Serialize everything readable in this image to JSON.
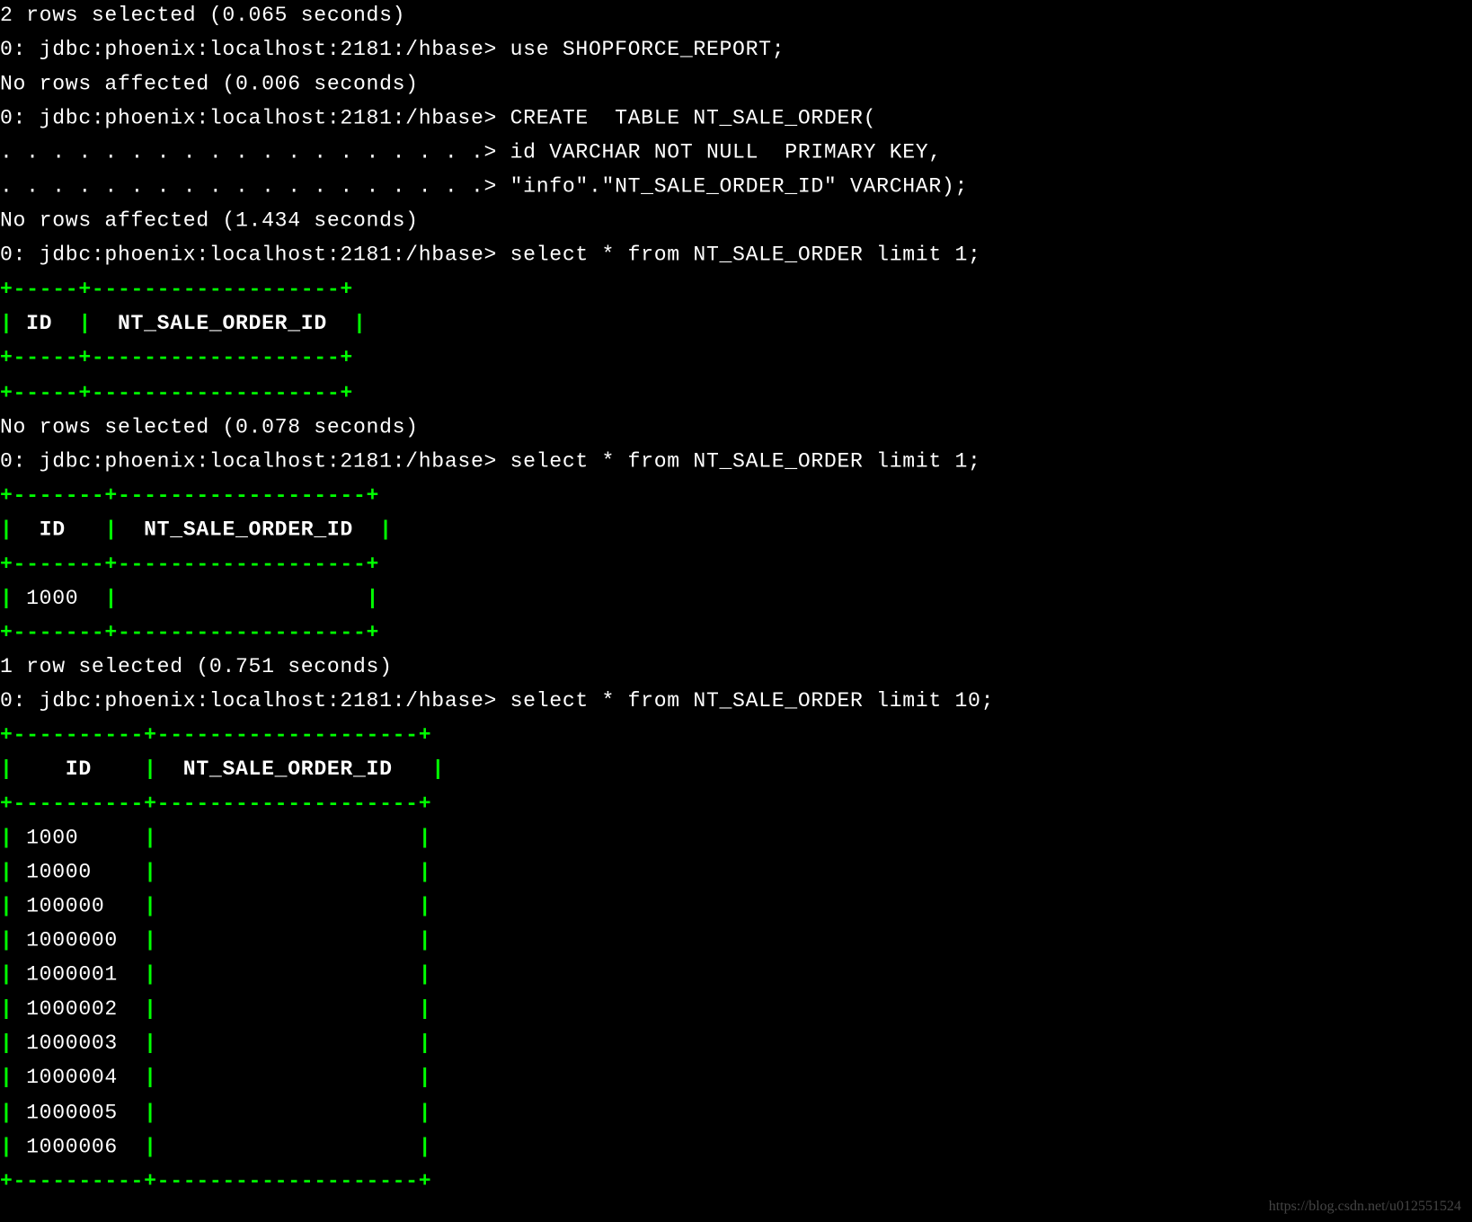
{
  "lines": [
    {
      "type": "white",
      "text": "2 rows selected (0.065 seconds)"
    },
    {
      "type": "prompt",
      "text": "0: jdbc:phoenix:localhost:2181:/hbase> ",
      "cmd": "use SHOPFORCE_REPORT;"
    },
    {
      "type": "white",
      "text": "No rows affected (0.006 seconds)"
    },
    {
      "type": "prompt",
      "text": "0: jdbc:phoenix:localhost:2181:/hbase> ",
      "cmd": "CREATE  TABLE NT_SALE_ORDER("
    },
    {
      "type": "cont",
      "text": ". . . . . . . . . . . . . . . . . . .> ",
      "cmd": "id VARCHAR NOT NULL  PRIMARY KEY,"
    },
    {
      "type": "cont",
      "text": ". . . . . . . . . . . . . . . . . . .> ",
      "cmd": "\"info\".\"NT_SALE_ORDER_ID\" VARCHAR);"
    },
    {
      "type": "white",
      "text": "No rows affected (1.434 seconds)"
    },
    {
      "type": "prompt",
      "text": "0: jdbc:phoenix:localhost:2181:/hbase> ",
      "cmd": "select * from NT_SALE_ORDER limit 1;"
    },
    {
      "type": "green",
      "text": "+-----+-------------------+"
    },
    {
      "type": "header1",
      "pipe": "|",
      "h1": " ID  ",
      "h2": "| ",
      "h3": " NT_SALE_ORDER_ID  ",
      "h4": "|"
    },
    {
      "type": "green",
      "text": "+-----+-------------------+"
    },
    {
      "type": "green",
      "text": "+-----+-------------------+"
    },
    {
      "type": "white",
      "text": "No rows selected (0.078 seconds)"
    },
    {
      "type": "prompt",
      "text": "0: jdbc:phoenix:localhost:2181:/hbase> ",
      "cmd": "select * from NT_SALE_ORDER limit 1;"
    },
    {
      "type": "green",
      "text": "+-------+-------------------+"
    },
    {
      "type": "header2",
      "pipe": "|",
      "h1": "  ID   ",
      "h2": "| ",
      "h3": " NT_SALE_ORDER_ID  ",
      "h4": "|"
    },
    {
      "type": "green",
      "text": "+-------+-------------------+"
    },
    {
      "type": "row1",
      "pipe": "|",
      "c1": " 1000  ",
      "p2": "|",
      "c2": "                   ",
      "p3": "|"
    },
    {
      "type": "green",
      "text": "+-------+-------------------+"
    },
    {
      "type": "white",
      "text": "1 row selected (0.751 seconds)"
    },
    {
      "type": "prompt",
      "text": "0: jdbc:phoenix:localhost:2181:/hbase> ",
      "cmd": "select * from NT_SALE_ORDER limit 10;"
    },
    {
      "type": "green",
      "text": "+----------+--------------------+"
    },
    {
      "type": "header3",
      "pipe": "|",
      "h1": "    ID    ",
      "h2": "| ",
      "h3": " NT_SALE_ORDER_ID   ",
      "h4": "|"
    },
    {
      "type": "green",
      "text": "+----------+--------------------+"
    },
    {
      "type": "row2",
      "pipe": "|",
      "c1": " 1000     ",
      "p2": "|",
      "c2": "                    ",
      "p3": "|"
    },
    {
      "type": "row2",
      "pipe": "|",
      "c1": " 10000    ",
      "p2": "|",
      "c2": "                    ",
      "p3": "|"
    },
    {
      "type": "row2",
      "pipe": "|",
      "c1": " 100000   ",
      "p2": "|",
      "c2": "                    ",
      "p3": "|"
    },
    {
      "type": "row2",
      "pipe": "|",
      "c1": " 1000000  ",
      "p2": "|",
      "c2": "                    ",
      "p3": "|"
    },
    {
      "type": "row2",
      "pipe": "|",
      "c1": " 1000001  ",
      "p2": "|",
      "c2": "                    ",
      "p3": "|"
    },
    {
      "type": "row2",
      "pipe": "|",
      "c1": " 1000002  ",
      "p2": "|",
      "c2": "                    ",
      "p3": "|"
    },
    {
      "type": "row2",
      "pipe": "|",
      "c1": " 1000003  ",
      "p2": "|",
      "c2": "                    ",
      "p3": "|"
    },
    {
      "type": "row2",
      "pipe": "|",
      "c1": " 1000004  ",
      "p2": "|",
      "c2": "                    ",
      "p3": "|"
    },
    {
      "type": "row2",
      "pipe": "|",
      "c1": " 1000005  ",
      "p2": "|",
      "c2": "                    ",
      "p3": "|"
    },
    {
      "type": "row2",
      "pipe": "|",
      "c1": " 1000006  ",
      "p2": "|",
      "c2": "                    ",
      "p3": "|"
    },
    {
      "type": "green",
      "text": "+----------+--------------------+"
    }
  ],
  "watermark": "https://blog.csdn.net/u012551524"
}
